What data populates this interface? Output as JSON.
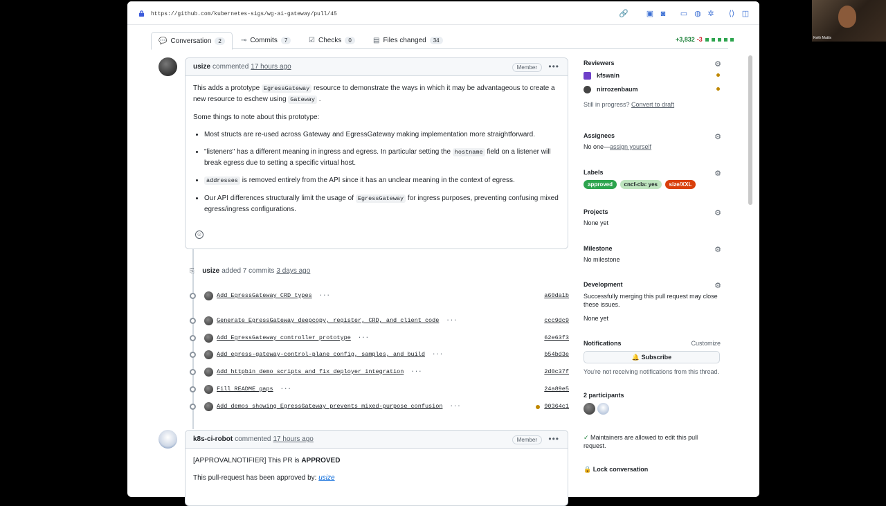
{
  "browser": {
    "url": "https://github.com/kubernetes-sigs/wg-ai-gateway/pull/45"
  },
  "tabs": [
    {
      "label": "Conversation",
      "count": "2",
      "icon": "comment-discussion-icon"
    },
    {
      "label": "Commits",
      "count": "7",
      "icon": "git-commit-icon"
    },
    {
      "label": "Checks",
      "count": "0",
      "icon": "checklist-icon"
    },
    {
      "label": "Files changed",
      "count": "34",
      "icon": "file-diff-icon"
    }
  ],
  "diffstat": {
    "additions": "+3,832",
    "deletions": "-3"
  },
  "first_comment": {
    "author": "usize",
    "action": "commented",
    "time": "17 hours ago",
    "badge": "Member",
    "p1_a": "This adds a prototype ",
    "p1_code": "EgressGateway",
    "p1_b": " resource to demonstrate the ways in which it may be advantageous to create a new resource to eschew using ",
    "p1_code2": "Gateway",
    "p1_c": " .",
    "p2": "Some things to note about this prototype:",
    "b1": "Most structs are re-used across Gateway and EgressGateway making implementation more straightforward.",
    "b2_a": "\"listeners\" has a different meaning in ingress and egress. In particular setting the ",
    "b2_code": "hostname",
    "b2_b": " field on a listener will break egress due to setting a specific virtual host.",
    "b3_code": "addresses",
    "b3_a": " is removed entirely from the API since it has an unclear meaning in the context of egress.",
    "b4_a": "Our API differences structurally limit the usage of ",
    "b4_code": "EgressGateway",
    "b4_b": " for ingress purposes, preventing confusing mixed egress/ingress configurations."
  },
  "commits_event": {
    "author": "usize",
    "text": "added 7 commits",
    "time": "3 days ago"
  },
  "commits": [
    {
      "message": "Add EgressGateway CRD types",
      "sha": "a60da1b"
    },
    {
      "message": "Generate EgressGateway deepcopy, register, CRD, and client code",
      "sha": "ccc9dc9"
    },
    {
      "message": "Add EgressGateway controller prototype",
      "sha": "62e63f3"
    },
    {
      "message": "Add egress-gateway-control-plane config, samples, and build",
      "sha": "b54bd3e"
    },
    {
      "message": "Add httpbin demo scripts and fix deployer integration",
      "sha": "2d0c37f"
    },
    {
      "message": "Fill README gaps",
      "sha": "24a89e5"
    },
    {
      "message": "Add demos showing EgressGateway prevents mixed-purpose confusion",
      "sha": "90364c1"
    }
  ],
  "second_comment": {
    "author": "k8s-ci-robot",
    "action": "commented",
    "time": "17 hours ago",
    "badge": "Member",
    "line1_a": "[APPROVALNOTIFIER] This PR is ",
    "line1_b": "APPROVED",
    "line2_a": "This pull-request has been approved by: ",
    "line2_b": "usize"
  },
  "sidebar": {
    "reviewers_title": "Reviewers",
    "reviewers": [
      "kfswain",
      "nirrozenbaum"
    ],
    "still_in_progress": "Still in progress?",
    "convert_to_draft": "Convert to draft",
    "assignees_title": "Assignees",
    "assignees_none": "No one—",
    "assign_yourself": "assign yourself",
    "labels_title": "Labels",
    "labels": [
      {
        "name": "approved",
        "bg": "#2da44e",
        "fg": "#ffffff"
      },
      {
        "name": "cncf-cla: yes",
        "bg": "#bfe5bf",
        "fg": "#1f2328"
      },
      {
        "name": "size/XXL",
        "bg": "#d93f0b",
        "fg": "#ffffff"
      }
    ],
    "projects_title": "Projects",
    "projects_value": "None yet",
    "milestone_title": "Milestone",
    "milestone_value": "No milestone",
    "development_title": "Development",
    "development_text": "Successfully merging this pull request may close these issues.",
    "development_value": "None yet",
    "notifications_title": "Notifications",
    "customize": "Customize",
    "subscribe": "Subscribe",
    "notif_text": "You're not receiving notifications from this thread.",
    "participants_title": "2 participants",
    "maintainers_text": "Maintainers are allowed to edit this pull request.",
    "lock_conversation": "Lock conversation"
  },
  "webcam": {
    "name": "Keith Mattix"
  }
}
